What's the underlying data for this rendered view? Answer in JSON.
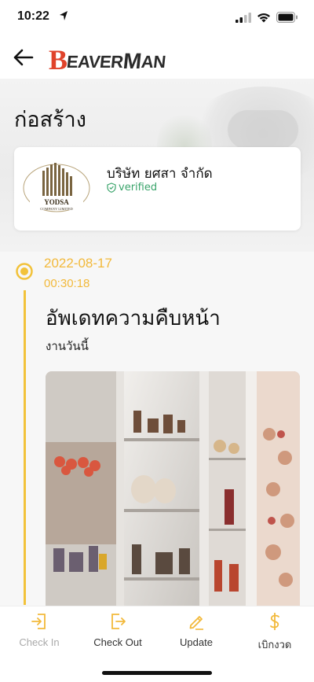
{
  "status_bar": {
    "time": "10:22"
  },
  "nav": {
    "logo_first": "B",
    "logo_mid": "EAVER",
    "logo_m": "M",
    "logo_end": "AN"
  },
  "page": {
    "title": "ก่อสร้าง"
  },
  "company": {
    "name": "บริษัท ยศสา จำกัด",
    "verified_label": "verified",
    "logo_text_1": "YODSA",
    "logo_text_2": "COMPANY LIMITED"
  },
  "timeline": {
    "date": "2022-08-17",
    "time": "00:30:18",
    "title": "อัพเดทความคืบหน้า",
    "description": "งานวันนี้"
  },
  "tabs": [
    {
      "label": "Check In",
      "icon": "check-in-icon"
    },
    {
      "label": "Check Out",
      "icon": "check-out-icon"
    },
    {
      "label": "Update",
      "icon": "pencil-icon"
    },
    {
      "label": "เบิกงวด",
      "icon": "dollar-icon"
    }
  ],
  "colors": {
    "accent": "#f2b93b",
    "verified": "#3aa46b",
    "logo_red": "#e0432b"
  }
}
